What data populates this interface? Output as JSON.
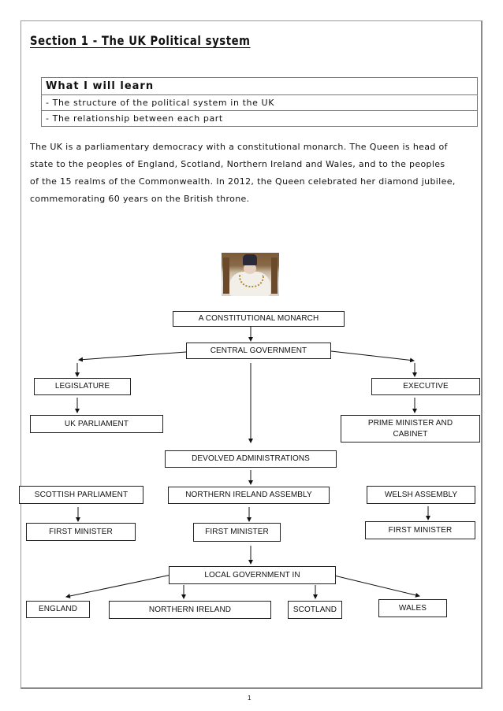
{
  "document": {
    "title": "Section 1 -  The UK Political system",
    "learning_box": {
      "heading": "What I will learn",
      "items": [
        "- The structure of the political system in the UK",
        "- The relationship between each part"
      ]
    },
    "intro_lines": [
      "The UK is a parliamentary democracy with a constitutional monarch. The Queen is head of",
      "state to the peoples of England, Scotland, Northern Ireland and Wales, and to the peoples",
      "of the 15 realms of the Commonwealth. In 2012, the Queen celebrated her diamond jubilee,",
      "commemorating 60 years on the British throne."
    ],
    "image": {
      "description": "photo of the Queen enthroned wearing crown and robes"
    },
    "page_number": "1"
  },
  "diagram": {
    "nodes": {
      "monarch": "A CONSTITUTIONAL MONARCH",
      "central_government": "CENTRAL GOVERNMENT",
      "legislature": "LEGISLATURE",
      "executive": "EXECUTIVE",
      "uk_parliament": "UK PARLIAMENT",
      "prime_minister": "PRIME MINISTER AND CABINET",
      "devolved": "DEVOLVED ADMINISTRATIONS",
      "scottish_parliament": "SCOTTISH PARLIAMENT",
      "ni_assembly": "NORTHERN IRELAND ASSEMBLY",
      "welsh_assembly": "WELSH ASSEMBLY",
      "first_minister_scotland": "FIRST MINISTER",
      "first_minister_ni": "FIRST MINISTER",
      "first_minister_wales": "FIRST MINISTER",
      "local_government": "LOCAL GOVERNMENT IN",
      "england": "ENGLAND",
      "northern_ireland": "NORTHERN IRELAND",
      "scotland": "SCOTLAND",
      "wales": "WALES"
    },
    "edges": [
      [
        "monarch",
        "central_government"
      ],
      [
        "central_government",
        "legislature"
      ],
      [
        "central_government",
        "executive"
      ],
      [
        "central_government",
        "devolved"
      ],
      [
        "legislature",
        "uk_parliament"
      ],
      [
        "executive",
        "prime_minister"
      ],
      [
        "devolved",
        "ni_assembly"
      ],
      [
        "scottish_parliament",
        "first_minister_scotland"
      ],
      [
        "ni_assembly",
        "first_minister_ni"
      ],
      [
        "welsh_assembly",
        "first_minister_wales"
      ],
      [
        "first_minister_ni",
        "local_government"
      ],
      [
        "local_government",
        "england"
      ],
      [
        "local_government",
        "northern_ireland"
      ],
      [
        "local_government",
        "scotland"
      ],
      [
        "local_government",
        "wales"
      ]
    ]
  }
}
